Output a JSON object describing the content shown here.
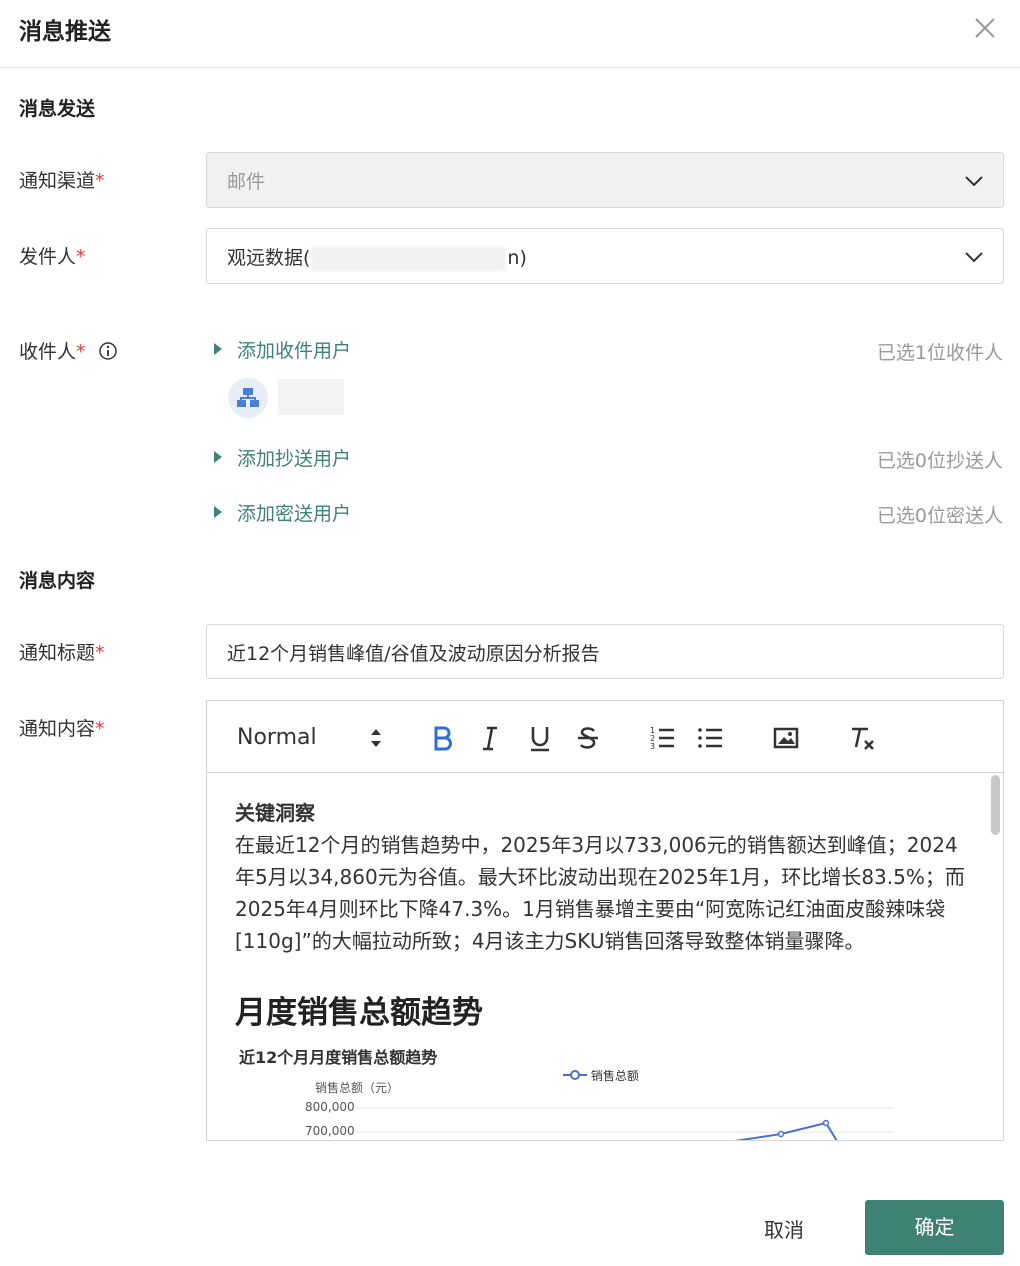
{
  "dialog": {
    "title": "消息推送"
  },
  "send_section": {
    "title": "消息发送"
  },
  "channel": {
    "label": "通知渠道",
    "value": "邮件"
  },
  "sender": {
    "label": "发件人",
    "value_prefix": "观远数据(",
    "value_suffix": "n)"
  },
  "recipients": {
    "label": "收件人",
    "add_to": "添加收件用户",
    "to_count": "已选1位收件人",
    "add_cc": "添加抄送用户",
    "cc_count": "已选0位抄送人",
    "add_bcc": "添加密送用户",
    "bcc_count": "已选0位密送人"
  },
  "content_section": {
    "title": "消息内容"
  },
  "notify_title": {
    "label": "通知标题",
    "value": "近12个月销售峰值/谷值及波动原因分析报告"
  },
  "notify_content": {
    "label": "通知内容"
  },
  "toolbar": {
    "format": "Normal"
  },
  "editor": {
    "heading_small": "关键洞察",
    "paragraph": "在最近12个月的销售趋势中，2025年3月以733,006元的销售额达到峰值；2024年5月以34,860元为谷值。最大环比波动出现在2025年1月，环比增长83.5%；而2025年4月则环比下降47.3%。1月销售暴增主要由“阿宽陈记红油面皮酸辣味袋[110g]”的大幅拉动所致；4月该主力SKU销售回落导致整体销量骤降。",
    "heading_large": "月度销售总额趋势"
  },
  "chart_data": {
    "type": "line",
    "title": "近12个月月度销售总额趋势",
    "ylabel": "销售总额（元）",
    "series": [
      {
        "name": "销售总额"
      }
    ],
    "yticks": [
      "800,000",
      "700,000"
    ]
  },
  "footer": {
    "cancel": "取消",
    "ok": "确定"
  },
  "colors": {
    "accent": "#3e8175",
    "link": "#3f8277",
    "required": "#e23a3a",
    "bold_active": "#2f6fd6"
  }
}
